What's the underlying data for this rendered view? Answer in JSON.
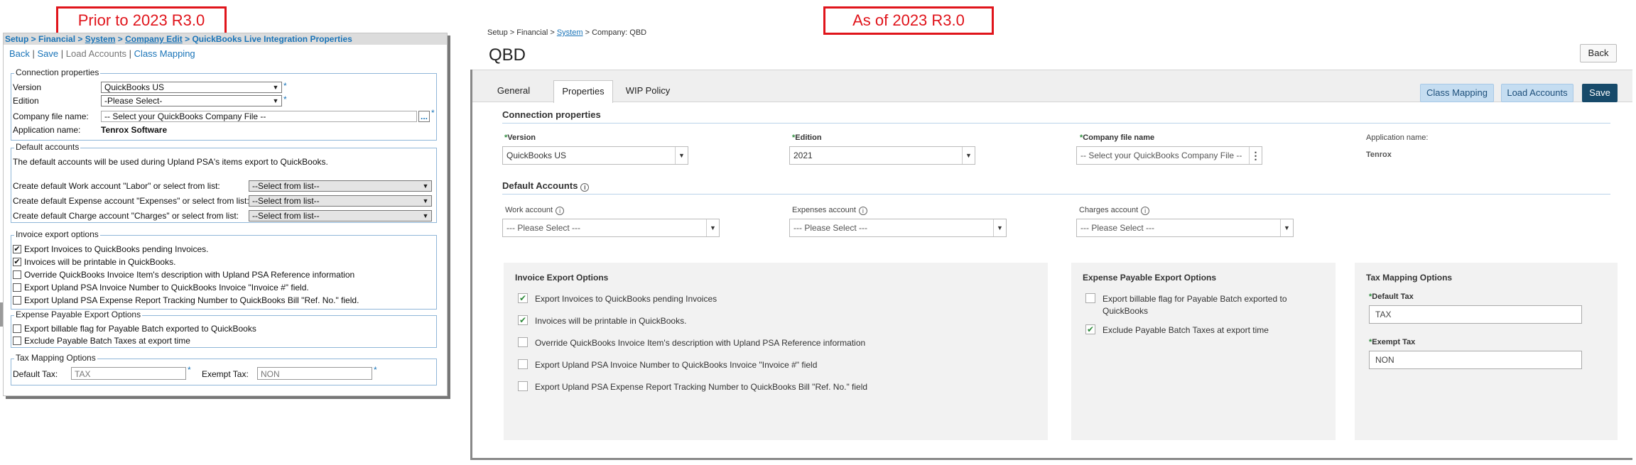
{
  "captions": {
    "old": "Prior to 2023 R3.0",
    "new": "As of 2023 R3.0"
  },
  "old": {
    "breadcrumb": {
      "p1": "Setup > Financial > ",
      "p2": "System",
      "p3": " > ",
      "p4": "Company Edit",
      "p5": " > QuickBooks Live Integration Properties"
    },
    "actions": {
      "back": "Back",
      "sep": " | ",
      "save": "Save",
      "load": "Load Accounts",
      "class": "Class Mapping"
    },
    "connection": {
      "legend": "Connection properties",
      "version_label": "Version",
      "version_value": "QuickBooks US",
      "edition_label": "Edition",
      "edition_value": "-Please Select-",
      "file_label": "Company file name:",
      "file_value": "-- Select your QuickBooks Company File --",
      "browse": "...",
      "app_label": "Application name:",
      "app_value": "Tenrox Software",
      "star": "*"
    },
    "accounts": {
      "legend": "Default accounts",
      "desc": "The default accounts will be used during Upland PSA's items export to QuickBooks.",
      "work": "Create default Work account \"Labor\" or select from list:",
      "expense": "Create default Expense account \"Expenses\" or select from list:",
      "charge": "Create default Charge account \"Charges\" or select from list:",
      "select": "--Select from list--"
    },
    "invoice": {
      "legend": "Invoice export options",
      "opt1": "Export Invoices to QuickBooks pending Invoices.",
      "opt2": "Invoices will be printable in QuickBooks.",
      "opt3": "Override QuickBooks Invoice Item's description with Upland PSA Reference information",
      "opt4": "Export Upland PSA Invoice Number to QuickBooks Invoice \"Invoice #\" field.",
      "opt5": "Export Upland PSA Expense Report Tracking Number to QuickBooks Bill \"Ref. No.\" field.",
      "check": "✔"
    },
    "payable": {
      "legend": "Expense Payable Export Options",
      "opt1": "Export billable flag for Payable Batch exported to QuickBooks",
      "opt2": "Exclude Payable Batch Taxes at export time"
    },
    "tax": {
      "legend": "Tax Mapping Options",
      "default_label": "Default Tax:",
      "default_value": "TAX",
      "exempt_label": "Exempt Tax:",
      "exempt_value": "NON"
    }
  },
  "new": {
    "breadcrumb": {
      "p1": "Setup > Financial > ",
      "p2": "System",
      "p3": " > Company: QBD"
    },
    "title": "QBD",
    "buttons": {
      "back": "Back",
      "class": "Class Mapping",
      "load": "Load Accounts",
      "save": "Save"
    },
    "tabs": [
      "General",
      "Properties",
      "WIP Policy"
    ],
    "connection": {
      "heading": "Connection properties",
      "version_label": "Version",
      "version_value": "QuickBooks US",
      "edition_label": "Edition",
      "edition_value": "2021",
      "file_label": "Company file name",
      "file_value": "-- Select your QuickBooks Company File --",
      "app_label": "Application name:",
      "app_value": "Tenrox",
      "req": "*"
    },
    "accounts": {
      "heading": "Default Accounts",
      "work_label": "Work account",
      "expenses_label": "Expenses account",
      "charges_label": "Charges account",
      "placeholder": "--- Please Select ---",
      "info": "i"
    },
    "invoice": {
      "heading": "Invoice Export Options",
      "opt1": "Export Invoices to QuickBooks pending Invoices",
      "opt2": "Invoices will be printable in QuickBooks.",
      "opt3": "Override QuickBooks Invoice Item's description with Upland PSA Reference information",
      "opt4": "Export Upland PSA Invoice Number to QuickBooks Invoice \"Invoice #\" field",
      "opt5": "Export Upland PSA Expense Report Tracking Number to QuickBooks Bill \"Ref. No.\" field",
      "check": "✔"
    },
    "payable": {
      "heading": "Expense Payable Export Options",
      "opt1a": "Export billable flag for Payable Batch exported to",
      "opt1b": "QuickBooks",
      "opt2": "Exclude Payable Batch Taxes at export time"
    },
    "tax": {
      "heading": "Tax Mapping Options",
      "default_label": "Default Tax",
      "default_value": "TAX",
      "exempt_label": "Exempt Tax",
      "exempt_value": "NON"
    },
    "dropdown_arrow": "▼",
    "kebab": "⋮"
  }
}
